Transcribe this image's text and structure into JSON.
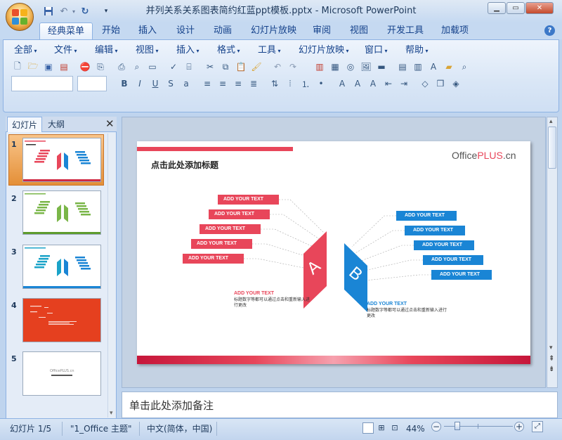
{
  "window": {
    "title": "并列关系关系图表简约红蓝ppt模板.pptx - Microsoft PowerPoint",
    "minimize": "▁",
    "maximize": "▭",
    "close": "✕"
  },
  "quick_access": {
    "save_icon": "save-icon",
    "undo_icon": "undo-icon",
    "redo_icon": "redo-icon",
    "more": "▾"
  },
  "tabs": [
    "经典菜单",
    "开始",
    "插入",
    "设计",
    "动画",
    "幻灯片放映",
    "审阅",
    "视图",
    "开发工具",
    "加载项"
  ],
  "classic_menu": [
    "全部",
    "文件",
    "编辑",
    "视图",
    "插入",
    "格式",
    "工具",
    "幻灯片放映",
    "窗口",
    "帮助"
  ],
  "pane": {
    "tab_slides": "幻灯片",
    "tab_outline": "大纲",
    "close": "✕"
  },
  "thumbnails": [
    {
      "num": "1",
      "theme": "red-blue",
      "selected": true
    },
    {
      "num": "2",
      "theme": "green"
    },
    {
      "num": "3",
      "theme": "blue"
    },
    {
      "num": "4",
      "theme": "orange"
    },
    {
      "num": "5",
      "theme": "blank",
      "text": "OfficePLUS.cn"
    }
  ],
  "slide": {
    "title": "点击此处添加标题",
    "brand_office": "Office",
    "brand_plus": "PLUS",
    "brand_cn": ".cn",
    "left_labels": [
      "ADD YOUR TEXT",
      "ADD YOUR TEXT",
      "ADD YOUR TEXT",
      "ADD YOUR TEXT",
      "ADD YOUR TEXT"
    ],
    "right_labels": [
      "ADD YOUR TEXT",
      "ADD YOUR TEXT",
      "ADD YOUR TEXT",
      "ADD YOUR TEXT",
      "ADD YOUR TEXT"
    ],
    "letter_a": "A",
    "letter_b": "B",
    "caption_a_title": "ADD YOUR TEXT",
    "caption_a_body": "标题数字等都可以通过点击和重新输入进行更改",
    "caption_b_title": "ADD YOUR TEXT",
    "caption_b_body": "标题数字等都可以通过点击和重新输入进行更改",
    "colors": {
      "red": "#e8465a",
      "blue": "#1a85d5"
    }
  },
  "notes": {
    "placeholder": "单击此处添加备注"
  },
  "status": {
    "slide_info": "幻灯片 1/5",
    "theme": "\"1_Office 主题\"",
    "language": "中文(简体，中国)",
    "zoom": "44%",
    "zoom_out": "−",
    "zoom_in": "+"
  }
}
